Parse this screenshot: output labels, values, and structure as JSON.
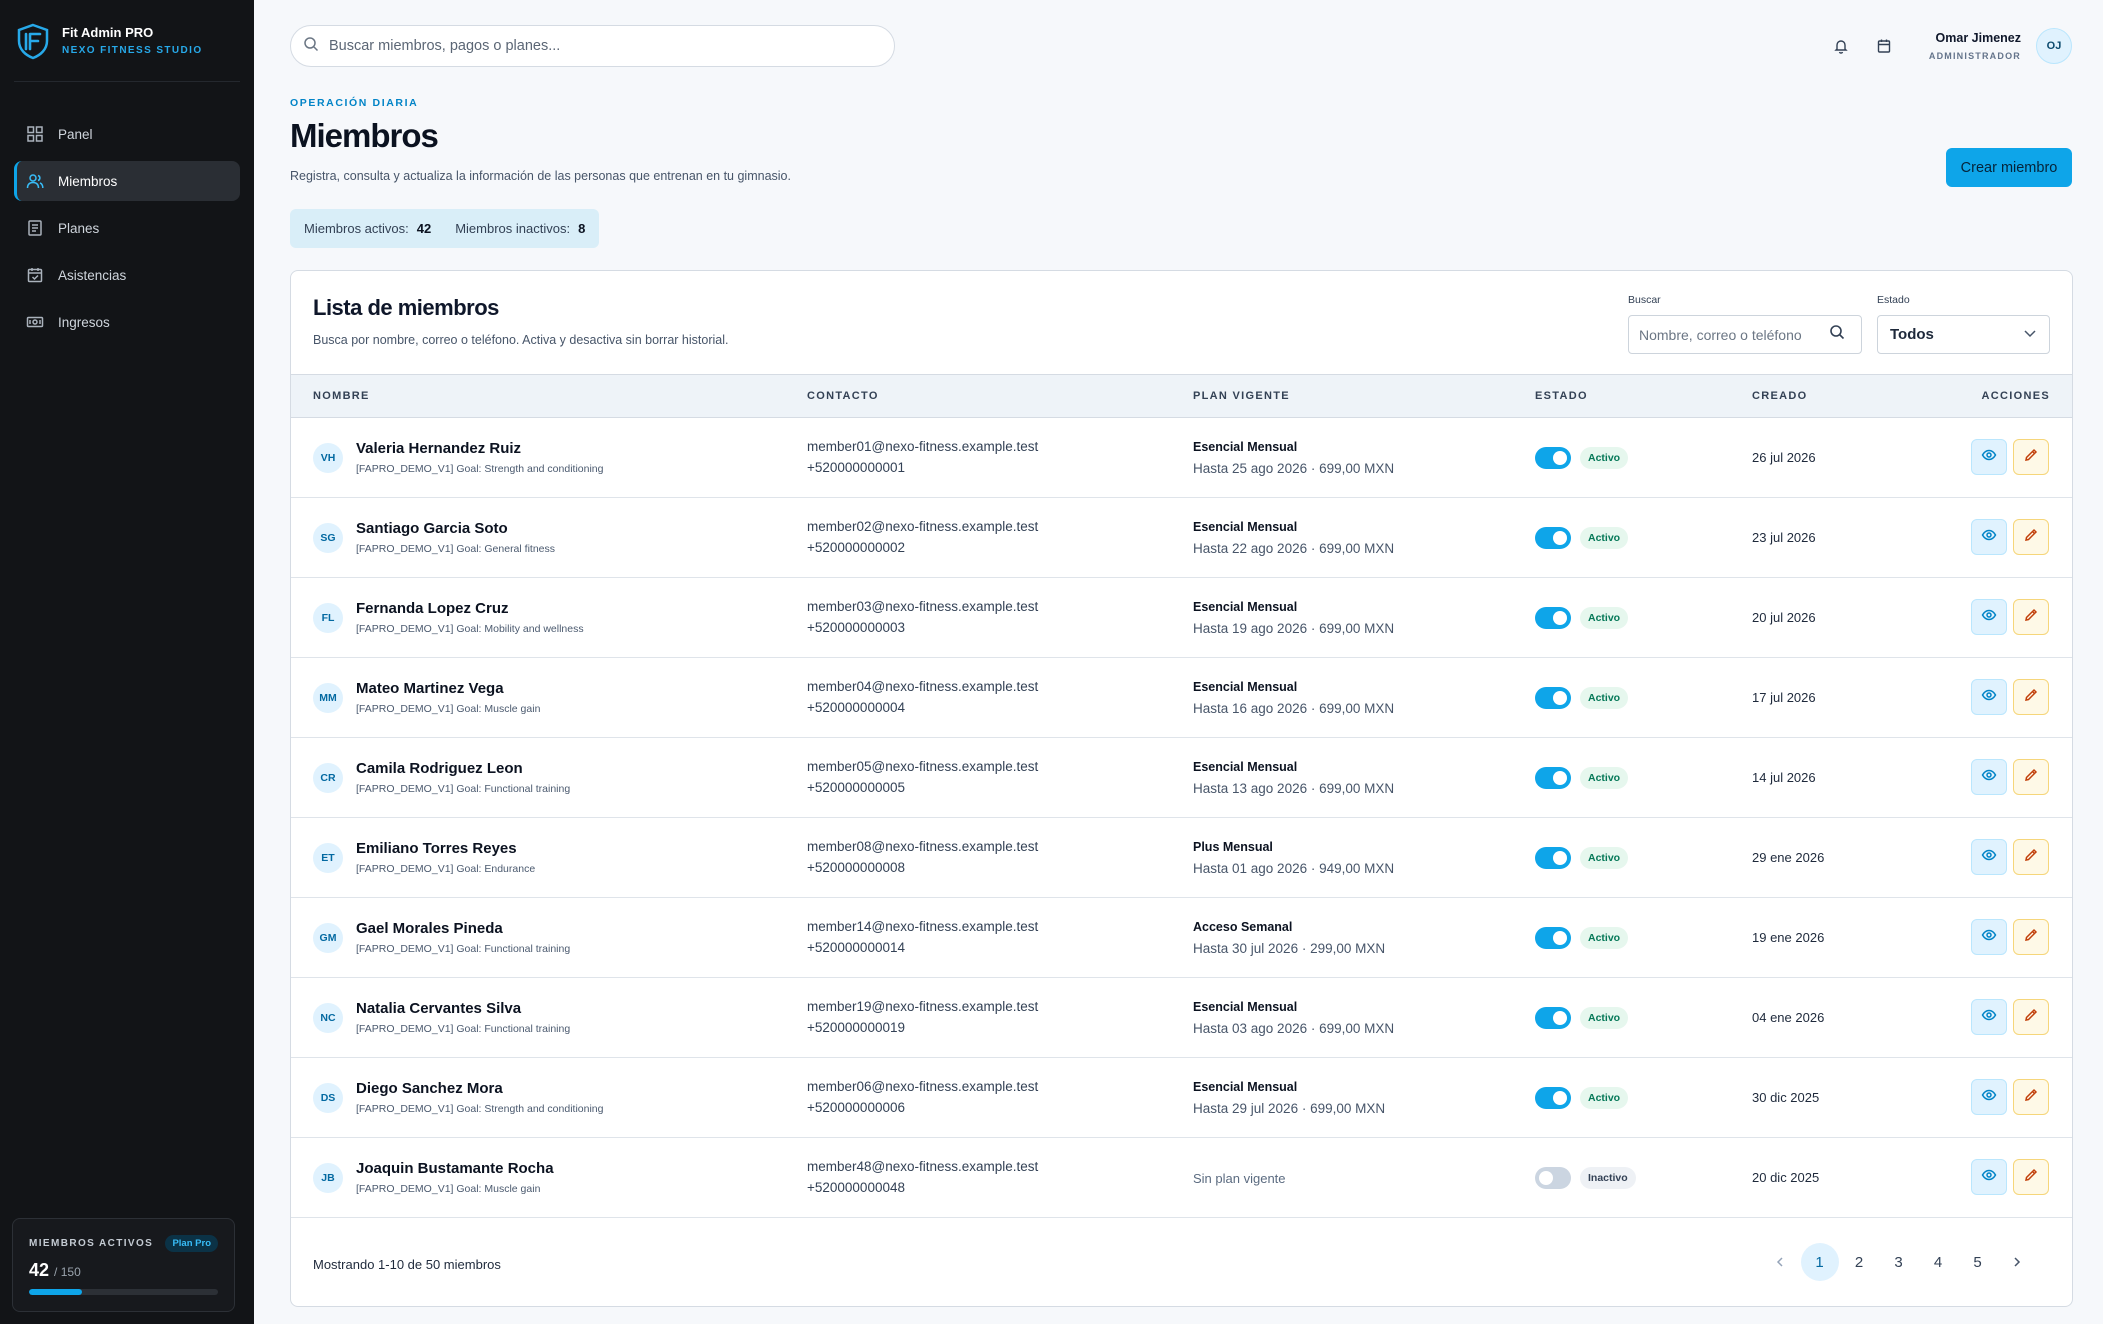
{
  "brand": {
    "name": "Fit Admin PRO",
    "subtitle": "NEXO FITNESS STUDIO"
  },
  "sidebar": {
    "items": [
      {
        "label": "Panel",
        "icon": "grid-icon"
      },
      {
        "label": "Miembros",
        "icon": "users-icon",
        "active": true
      },
      {
        "label": "Planes",
        "icon": "document-icon"
      },
      {
        "label": "Asistencias",
        "icon": "calendar-check-icon"
      },
      {
        "label": "Ingresos",
        "icon": "cash-icon"
      }
    ],
    "card": {
      "title": "MIEMBROS ACTIVOS",
      "plan": "Plan Pro",
      "count": "42",
      "limit": "/ 150",
      "progress": 0.28
    }
  },
  "topbar": {
    "search_placeholder": "Buscar miembros, pagos o planes...",
    "user_name": "Omar Jimenez",
    "user_role": "ADMINISTRADOR",
    "user_initials": "OJ"
  },
  "header": {
    "eyebrow": "OPERACIÓN DIARIA",
    "title": "Miembros",
    "description": "Registra, consulta y actualiza la información de las personas que entrenan en tu gimnasio.",
    "create_button": "Crear miembro",
    "stats": {
      "active_label": "Miembros activos:",
      "active_value": "42",
      "inactive_label": "Miembros inactivos:",
      "inactive_value": "8"
    }
  },
  "list": {
    "title": "Lista de miembros",
    "subtitle": "Busca por nombre, correo o teléfono. Activa y desactiva sin borrar historial.",
    "search_label": "Buscar",
    "search_placeholder": "Nombre, correo o teléfono",
    "status_label": "Estado",
    "status_value": "Todos",
    "columns": [
      "NOMBRE",
      "CONTACTO",
      "PLAN VIGENTE",
      "ESTADO",
      "CREADO",
      "ACCIONES"
    ],
    "rows": [
      {
        "initials": "VH",
        "name": "Valeria Hernandez Ruiz",
        "goal": "[FAPRO_DEMO_V1] Goal: Strength and conditioning",
        "email": "member01@nexo-fitness.example.test",
        "phone": "+520000000001",
        "plan": "Esencial Mensual",
        "plan_detail": "Hasta 25 ago 2026 · 699,00 MXN",
        "status": "Activo",
        "active": true,
        "created": "26 jul 2026"
      },
      {
        "initials": "SG",
        "name": "Santiago Garcia Soto",
        "goal": "[FAPRO_DEMO_V1] Goal: General fitness",
        "email": "member02@nexo-fitness.example.test",
        "phone": "+520000000002",
        "plan": "Esencial Mensual",
        "plan_detail": "Hasta 22 ago 2026 · 699,00 MXN",
        "status": "Activo",
        "active": true,
        "created": "23 jul 2026"
      },
      {
        "initials": "FL",
        "name": "Fernanda Lopez Cruz",
        "goal": "[FAPRO_DEMO_V1] Goal: Mobility and wellness",
        "email": "member03@nexo-fitness.example.test",
        "phone": "+520000000003",
        "plan": "Esencial Mensual",
        "plan_detail": "Hasta 19 ago 2026 · 699,00 MXN",
        "status": "Activo",
        "active": true,
        "created": "20 jul 2026"
      },
      {
        "initials": "MM",
        "name": "Mateo Martinez Vega",
        "goal": "[FAPRO_DEMO_V1] Goal: Muscle gain",
        "email": "member04@nexo-fitness.example.test",
        "phone": "+520000000004",
        "plan": "Esencial Mensual",
        "plan_detail": "Hasta 16 ago 2026 · 699,00 MXN",
        "status": "Activo",
        "active": true,
        "created": "17 jul 2026"
      },
      {
        "initials": "CR",
        "name": "Camila Rodriguez Leon",
        "goal": "[FAPRO_DEMO_V1] Goal: Functional training",
        "email": "member05@nexo-fitness.example.test",
        "phone": "+520000000005",
        "plan": "Esencial Mensual",
        "plan_detail": "Hasta 13 ago 2026 · 699,00 MXN",
        "status": "Activo",
        "active": true,
        "created": "14 jul 2026"
      },
      {
        "initials": "ET",
        "name": "Emiliano Torres Reyes",
        "goal": "[FAPRO_DEMO_V1] Goal: Endurance",
        "email": "member08@nexo-fitness.example.test",
        "phone": "+520000000008",
        "plan": "Plus Mensual",
        "plan_detail": "Hasta 01 ago 2026 · 949,00 MXN",
        "status": "Activo",
        "active": true,
        "created": "29 ene 2026"
      },
      {
        "initials": "GM",
        "name": "Gael Morales Pineda",
        "goal": "[FAPRO_DEMO_V1] Goal: Functional training",
        "email": "member14@nexo-fitness.example.test",
        "phone": "+520000000014",
        "plan": "Acceso Semanal",
        "plan_detail": "Hasta 30 jul 2026 · 299,00 MXN",
        "status": "Activo",
        "active": true,
        "created": "19 ene 2026"
      },
      {
        "initials": "NC",
        "name": "Natalia Cervantes Silva",
        "goal": "[FAPRO_DEMO_V1] Goal: Functional training",
        "email": "member19@nexo-fitness.example.test",
        "phone": "+520000000019",
        "plan": "Esencial Mensual",
        "plan_detail": "Hasta 03 ago 2026 · 699,00 MXN",
        "status": "Activo",
        "active": true,
        "created": "04 ene 2026"
      },
      {
        "initials": "DS",
        "name": "Diego Sanchez Mora",
        "goal": "[FAPRO_DEMO_V1] Goal: Strength and conditioning",
        "email": "member06@nexo-fitness.example.test",
        "phone": "+520000000006",
        "plan": "Esencial Mensual",
        "plan_detail": "Hasta 29 jul 2026 · 699,00 MXN",
        "status": "Activo",
        "active": true,
        "created": "30 dic 2025"
      },
      {
        "initials": "JB",
        "name": "Joaquin Bustamante Rocha",
        "goal": "[FAPRO_DEMO_V1] Goal: Muscle gain",
        "email": "member48@nexo-fitness.example.test",
        "phone": "+520000000048",
        "plan": "",
        "plan_detail": "",
        "no_plan": "Sin plan vigente",
        "status": "Inactivo",
        "active": false,
        "created": "20 dic 2025"
      }
    ],
    "footer": "Mostrando 1-10 de 50 miembros",
    "pages": [
      "1",
      "2",
      "3",
      "4",
      "5"
    ],
    "current_page": "1"
  },
  "colors": {
    "accent": "#0ea5e9",
    "sidebar_bg": "#121417",
    "active_badge": "#047857"
  }
}
